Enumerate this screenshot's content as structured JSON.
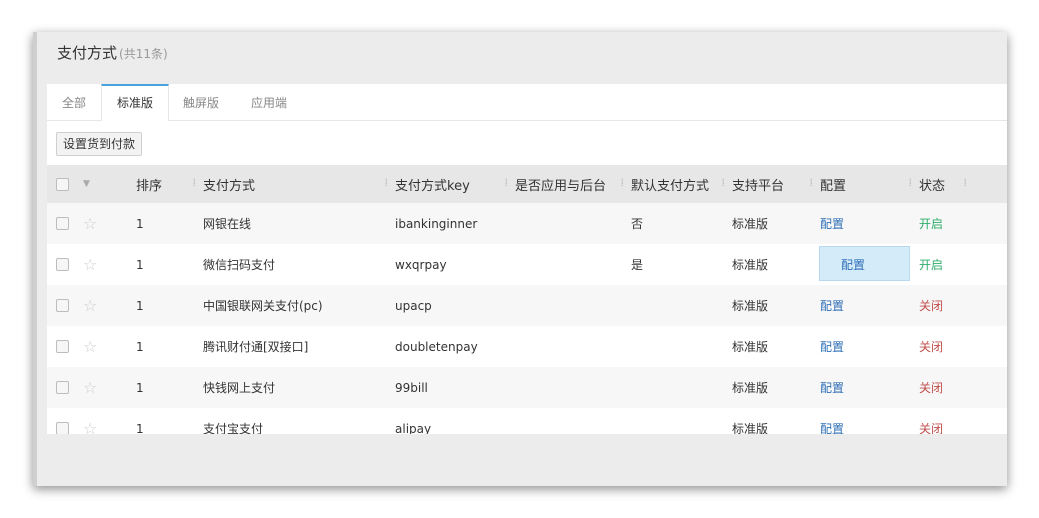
{
  "header": {
    "title": "支付方式",
    "count": "(共11条)"
  },
  "tabs": [
    {
      "label": "全部",
      "active": false
    },
    {
      "label": "标准版",
      "active": true
    },
    {
      "label": "触屏版",
      "active": false
    },
    {
      "label": "应用端",
      "active": false
    }
  ],
  "toolbar": {
    "set_cod_label": "设置货到付款"
  },
  "table": {
    "columns": [
      "排序",
      "支付方式",
      "支付方式key",
      "是否应用与后台",
      "默认支付方式",
      "支持平台",
      "配置",
      "状态"
    ],
    "rows": [
      {
        "sort": "1",
        "name": "网银在线",
        "key": "ibankinginner",
        "backend": "",
        "default": "否",
        "platform": "标准版",
        "config": "配置",
        "status": "开启",
        "status_on": true
      },
      {
        "sort": "1",
        "name": "微信扫码支付",
        "key": "wxqrpay",
        "backend": "",
        "default": "是",
        "platform": "标准版",
        "config": "配置",
        "status": "开启",
        "status_on": true
      },
      {
        "sort": "1",
        "name": "中国银联网关支付(pc)",
        "key": "upacp",
        "backend": "",
        "default": "",
        "platform": "标准版",
        "config": "配置",
        "status": "关闭",
        "status_on": false
      },
      {
        "sort": "1",
        "name": "腾讯财付通[双接口]",
        "key": "doubletenpay",
        "backend": "",
        "default": "",
        "platform": "标准版",
        "config": "配置",
        "status": "关闭",
        "status_on": false
      },
      {
        "sort": "1",
        "name": "快钱网上支付",
        "key": "99bill",
        "backend": "",
        "default": "",
        "platform": "标准版",
        "config": "配置",
        "status": "关闭",
        "status_on": false
      },
      {
        "sort": "1",
        "name": "支付宝支付",
        "key": "alipay",
        "backend": "",
        "default": "",
        "platform": "标准版",
        "config": "配置",
        "status": "关闭",
        "status_on": false
      }
    ]
  },
  "icons": {
    "row_star": "star-outline-icon",
    "header_caret": "caret-down-icon",
    "column_separator": "drag-handle-icon"
  },
  "colors": {
    "accent": "#4aa3df",
    "link": "#2f6fb7",
    "status_on": "#2fae6b",
    "status_off": "#c0504d",
    "highlight": "#d4ebfa"
  }
}
